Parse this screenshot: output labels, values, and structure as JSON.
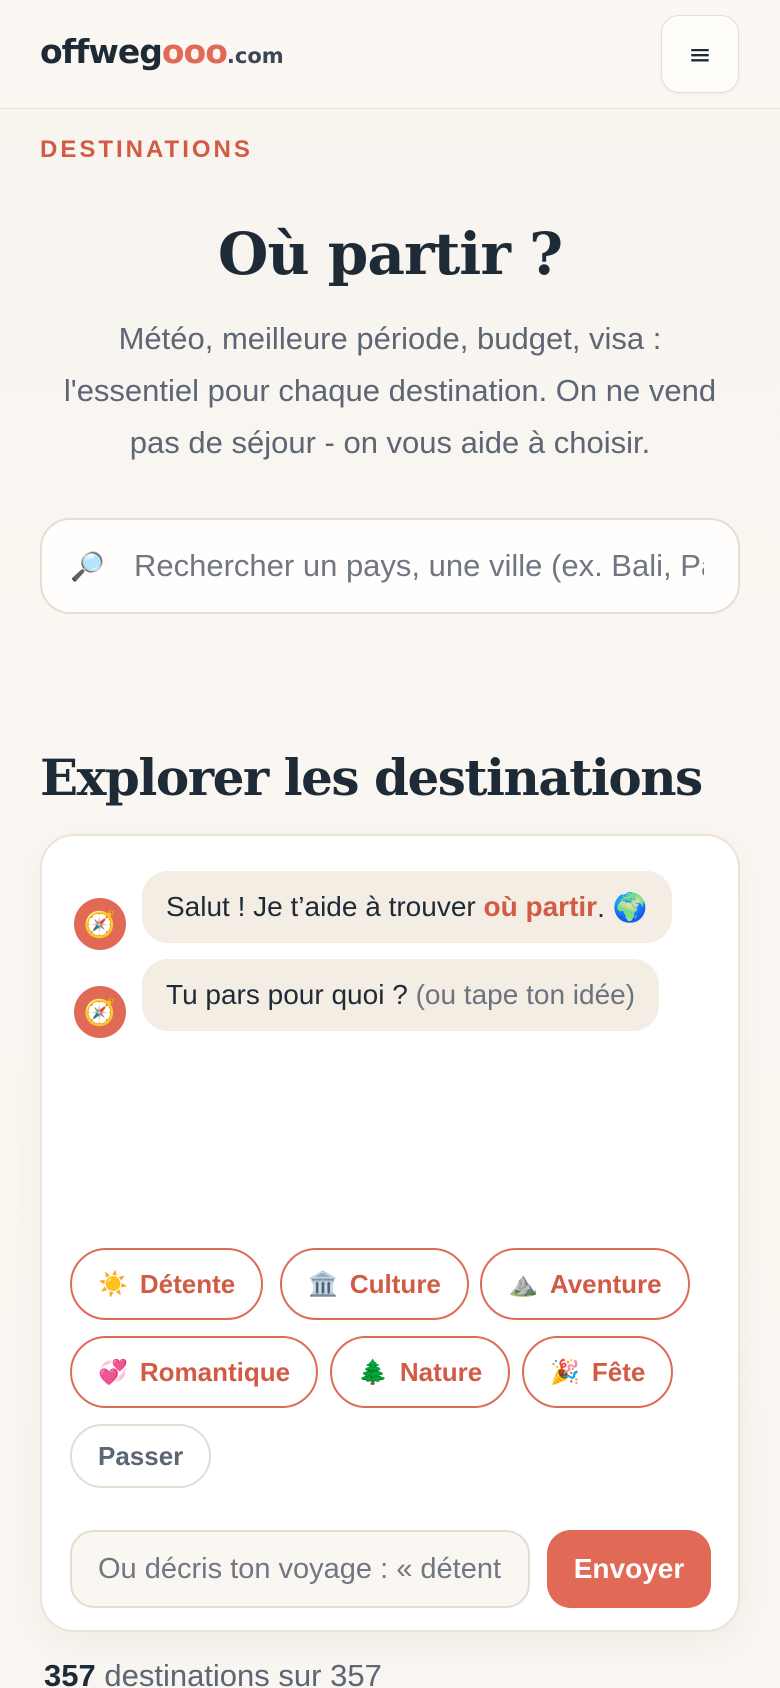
{
  "header": {
    "logo_main": "offweg",
    "logo_accent": "ooo",
    "logo_tld": ".com",
    "menu_glyph": "≡",
    "menu_icon": "hamburger-icon"
  },
  "hero": {
    "eyebrow": "DESTINATIONS",
    "title": "Où partir ?",
    "subtitle": "Météo, meilleure période, budget, visa : l'essentiel pour chaque destination. On ne vend pas de séjour - on vous aide à choisir."
  },
  "search": {
    "icon": "🔎",
    "placeholder": "Rechercher un pays, une ville (ex. Bali, Paris...)"
  },
  "explore": {
    "title": "Explorer les destinations"
  },
  "chat": {
    "avatar_icon": "🧭",
    "messages": [
      {
        "before": "Salut ! Je t’aide à trouver ",
        "highlight": "où partir",
        "after": ". 🌍"
      },
      {
        "text": "Tu pars pour quoi ? ",
        "muted": "(ou tape ton idée)"
      }
    ],
    "chips": [
      {
        "emoji": "☀️",
        "label": "Détente"
      },
      {
        "emoji": "🏛️",
        "label": "Culture"
      },
      {
        "emoji": "⛰️",
        "label": "Aventure"
      },
      {
        "emoji": "💞",
        "label": "Romantique"
      },
      {
        "emoji": "🌲",
        "label": "Nature"
      },
      {
        "emoji": "🎉",
        "label": "Fête"
      }
    ],
    "skip_label": "Passer",
    "input_placeholder": "Ou décris ton voyage : « détente au soleil »",
    "send_label": "Envoyer"
  },
  "results": {
    "count": "357",
    "suffix": " destinations sur 357"
  },
  "colors": {
    "accent": "#e06a55",
    "accent_text": "#d15b44",
    "ink": "#1f2a37"
  }
}
